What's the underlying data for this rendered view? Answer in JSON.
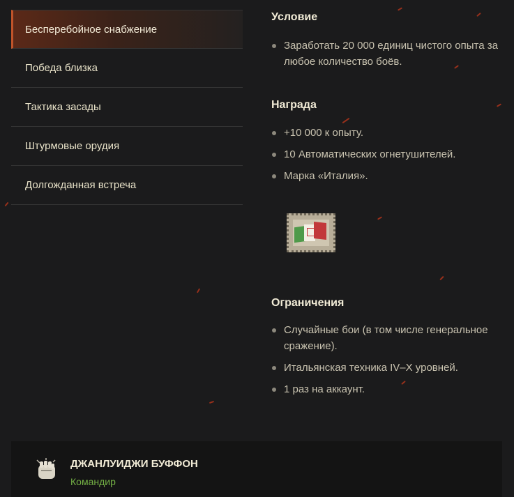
{
  "sidebar": {
    "items": [
      {
        "label": "Бесперебойное снабжение",
        "active": true
      },
      {
        "label": "Победа близка"
      },
      {
        "label": "Тактика засады"
      },
      {
        "label": "Штурмовые орудия"
      },
      {
        "label": "Долгожданная встреча"
      }
    ]
  },
  "condition": {
    "title": "Условие",
    "items": [
      "Заработать 20 000 единиц чистого опыта за любое количество боёв."
    ]
  },
  "reward": {
    "title": "Награда",
    "items": [
      "+10 000 к опыту.",
      "10 Автоматических огнетушителей.",
      "Марка «Италия»."
    ],
    "stamp_icon": "italy-stamp-icon"
  },
  "restrictions": {
    "title": "Ограничения",
    "items": [
      "Случайные бои (в том числе генеральное сражение).",
      "Итальянская техника IV–X уровней.",
      "1 раз на аккаунт."
    ]
  },
  "commander": {
    "name": "ДЖАНЛУИДЖИ БУФФОН",
    "role": "Командир",
    "icon": "fist-icon"
  },
  "colors": {
    "background": "#1b1b1c",
    "accent": "#c0542a",
    "role_green": "#74b045"
  }
}
